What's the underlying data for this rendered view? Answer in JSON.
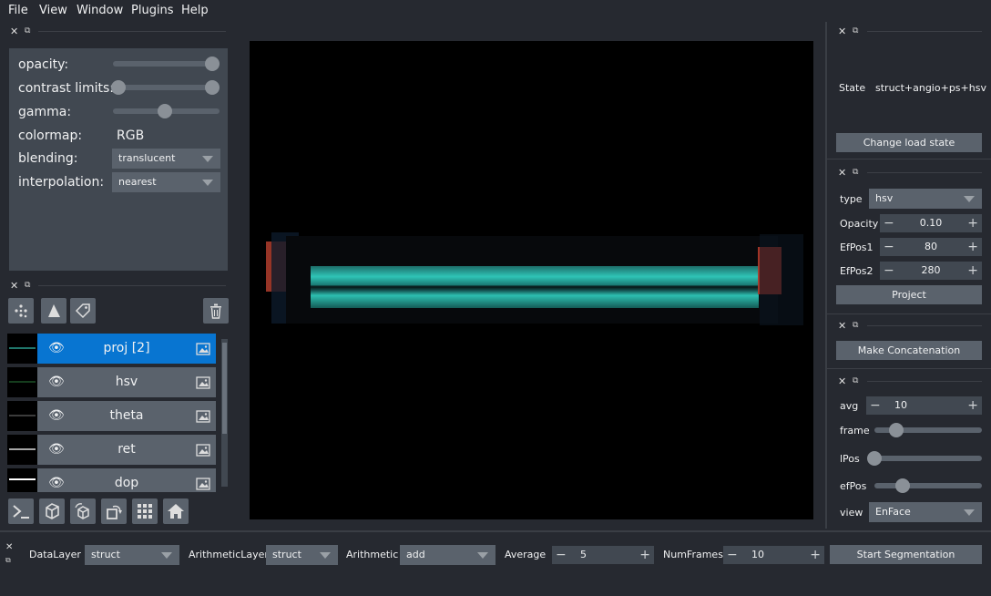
{
  "menu": [
    "File",
    "View",
    "Window",
    "Plugins",
    "Help"
  ],
  "layer_controls": {
    "opacity_label": "opacity:",
    "opacity_value": 1.0,
    "contrast_label": "contrast limits:",
    "contrast_range": [
      0,
      1
    ],
    "gamma_label": "gamma:",
    "gamma_value": 0.5,
    "colormap_label": "colormap:",
    "colormap_value": "RGB",
    "blending_label": "blending:",
    "blending_value": "translucent",
    "interpolation_label": "interpolation:",
    "interpolation_value": "nearest"
  },
  "layers": [
    {
      "name": "proj [2]",
      "selected": true
    },
    {
      "name": "hsv",
      "selected": false
    },
    {
      "name": "theta",
      "selected": false
    },
    {
      "name": "ret",
      "selected": false
    },
    {
      "name": "dop",
      "selected": false
    }
  ],
  "right": {
    "state_label": "State",
    "state_value": "struct+angio+ps+hsv",
    "change_load_state": "Change load state",
    "type_label": "type",
    "type_value": "hsv",
    "opacity_label": "Opacity",
    "opacity_value": "0.10",
    "efpos1_label": "EfPos1",
    "efpos1_value": "80",
    "efpos2_label": "EfPos2",
    "efpos2_value": "280",
    "project_button": "Project",
    "make_concat_button": "Make Concatenation",
    "avg_label": "avg",
    "avg_value": "10",
    "frame_label": "frame",
    "frame_value": 0.2,
    "lpos_label": "lPos",
    "lpos_value": 0.0,
    "efpos_label": "efPos",
    "efpos_value": 0.25,
    "view_label": "view",
    "view_value": "EnFace"
  },
  "bottom": {
    "datalayer_label": "DataLayer",
    "datalayer_value": "struct",
    "arithlayer_label": "ArithmeticLayer",
    "arithlayer_value": "struct",
    "arith_label": "Arithmetic",
    "arith_value": "add",
    "average_label": "Average",
    "average_value": "5",
    "numframes_label": "NumFrames",
    "numframes_value": "10",
    "start_button": "Start Segmentation"
  },
  "colors": {
    "background": "#262930",
    "panel": "#414851",
    "control": "#5a626c",
    "selected": "#0875d1"
  }
}
